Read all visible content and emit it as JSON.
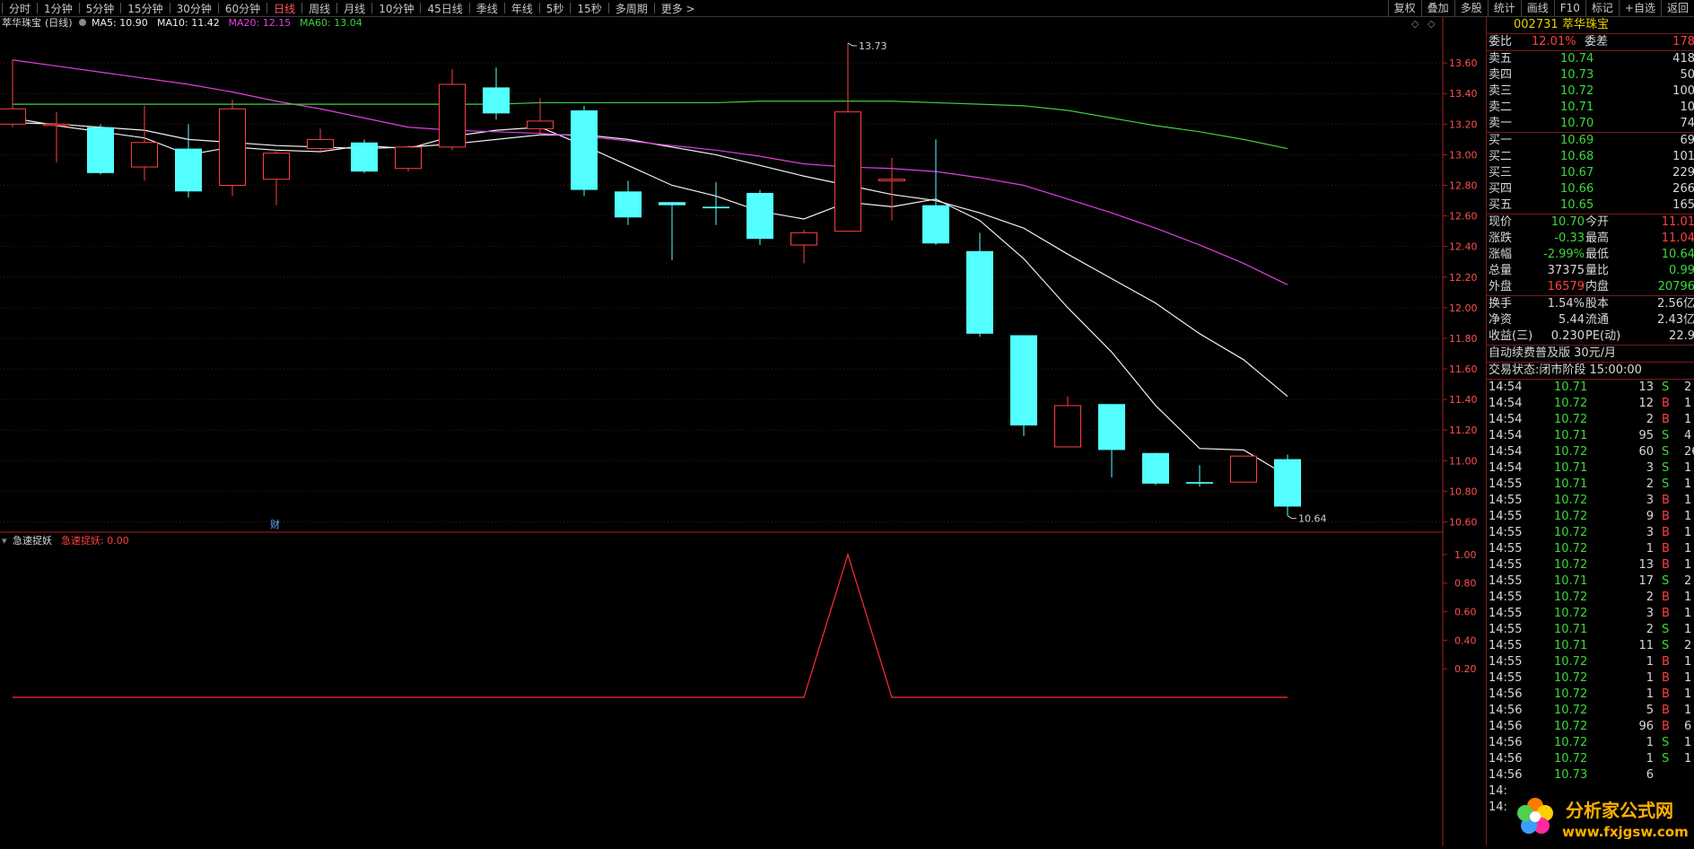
{
  "toolbar": {
    "tabs": [
      "分时",
      "1分钟",
      "5分钟",
      "15分钟",
      "30分钟",
      "60分钟",
      "日线",
      "周线",
      "月线",
      "10分钟",
      "45日线",
      "季线",
      "年线",
      "5秒",
      "15秒",
      "多周期",
      "更多 >"
    ],
    "active": "日线",
    "tools": [
      "复权",
      "叠加",
      "多股",
      "统计",
      "画线",
      "F10",
      "标记",
      "+自选",
      "返回"
    ]
  },
  "legend": {
    "name": "萃华珠宝",
    "period": "(日线)",
    "items": [
      {
        "label": "MA5: 10.90",
        "color": "#f0f0f0"
      },
      {
        "label": "MA10: 11.42",
        "color": "#f0f0f0"
      },
      {
        "label": "MA20: 12.15",
        "color": "#e040e0"
      },
      {
        "label": "MA60: 13.04",
        "color": "#40d040"
      }
    ]
  },
  "indicator": {
    "name": "急速捉妖",
    "label": "急速捉妖: 0.00",
    "color": "#ff4040"
  },
  "marker": {
    "text": "财"
  },
  "chart_data": [
    {
      "type": "candlestick",
      "title": "萃华珠宝 (日线)",
      "ylim": [
        10.55,
        13.9
      ],
      "yticks": [
        "13.60",
        "13.40",
        "13.20",
        "13.00",
        "12.80",
        "12.60",
        "12.40",
        "12.20",
        "12.00",
        "11.80",
        "11.60",
        "11.40",
        "11.20",
        "11.00",
        "10.80",
        "10.60"
      ],
      "annotations": [
        {
          "text": "13.73",
          "candle": 19,
          "value": 13.73
        },
        {
          "text": "10.64",
          "candle": 29,
          "value": 10.64
        }
      ],
      "candles": [
        {
          "o": 13.2,
          "h": 13.62,
          "l": 13.18,
          "c": 13.3
        },
        {
          "o": 13.2,
          "h": 13.28,
          "l": 12.95,
          "c": 13.2
        },
        {
          "o": 13.18,
          "h": 13.2,
          "l": 12.87,
          "c": 12.88
        },
        {
          "o": 12.92,
          "h": 13.32,
          "l": 12.83,
          "c": 13.08
        },
        {
          "o": 13.04,
          "h": 13.2,
          "l": 12.72,
          "c": 12.76
        },
        {
          "o": 12.8,
          "h": 13.36,
          "l": 12.73,
          "c": 13.3
        },
        {
          "o": 12.84,
          "h": 13.03,
          "l": 12.67,
          "c": 13.01
        },
        {
          "o": 13.04,
          "h": 13.17,
          "l": 13.02,
          "c": 13.1
        },
        {
          "o": 13.08,
          "h": 13.1,
          "l": 12.88,
          "c": 12.89
        },
        {
          "o": 12.91,
          "h": 13.06,
          "l": 12.89,
          "c": 13.05
        },
        {
          "o": 13.05,
          "h": 13.56,
          "l": 13.03,
          "c": 13.46
        },
        {
          "o": 13.44,
          "h": 13.57,
          "l": 13.23,
          "c": 13.27
        },
        {
          "o": 13.17,
          "h": 13.37,
          "l": 13.13,
          "c": 13.22
        },
        {
          "o": 13.29,
          "h": 13.32,
          "l": 12.73,
          "c": 12.77
        },
        {
          "o": 12.76,
          "h": 12.83,
          "l": 12.54,
          "c": 12.59
        },
        {
          "o": 12.69,
          "h": 12.69,
          "l": 12.31,
          "c": 12.67
        },
        {
          "o": 12.66,
          "h": 12.82,
          "l": 12.54,
          "c": 12.65
        },
        {
          "o": 12.75,
          "h": 12.77,
          "l": 12.41,
          "c": 12.45
        },
        {
          "o": 12.41,
          "h": 12.51,
          "l": 12.29,
          "c": 12.49
        },
        {
          "o": 12.5,
          "h": 13.73,
          "l": 12.5,
          "c": 13.28
        },
        {
          "o": 12.83,
          "h": 12.98,
          "l": 12.57,
          "c": 12.84
        },
        {
          "o": 12.67,
          "h": 13.1,
          "l": 12.41,
          "c": 12.42
        },
        {
          "o": 12.37,
          "h": 12.49,
          "l": 11.81,
          "c": 11.83
        },
        {
          "o": 11.82,
          "h": 11.82,
          "l": 11.16,
          "c": 11.23
        },
        {
          "o": 11.09,
          "h": 11.42,
          "l": 11.09,
          "c": 11.36
        },
        {
          "o": 11.37,
          "h": 11.37,
          "l": 10.89,
          "c": 11.07
        },
        {
          "o": 11.05,
          "h": 11.05,
          "l": 10.84,
          "c": 10.85
        },
        {
          "o": 10.86,
          "h": 10.97,
          "l": 10.83,
          "c": 10.85
        },
        {
          "o": 10.86,
          "h": 11.03,
          "l": 10.86,
          "c": 11.03
        },
        {
          "o": 11.01,
          "h": 11.04,
          "l": 10.64,
          "c": 10.7
        }
      ],
      "ma": [
        {
          "name": "MA5",
          "color": "#f0f0f0",
          "start": 0,
          "values": [
            13.24,
            13.19,
            13.15,
            13.11,
            13.0,
            13.05,
            13.03,
            13.02,
            13.06,
            13.04,
            13.12,
            13.16,
            13.18,
            13.06,
            12.93,
            12.8,
            12.73,
            12.63,
            12.58,
            12.69,
            12.66,
            12.71,
            12.57,
            12.32,
            12.0,
            11.71,
            11.36,
            11.08,
            11.07,
            10.9
          ]
        },
        {
          "name": "MA10",
          "color": "#f0f0f0",
          "start": 0,
          "values": [
            13.21,
            13.2,
            13.18,
            13.16,
            13.1,
            13.08,
            13.06,
            13.05,
            13.04,
            13.05,
            13.07,
            13.1,
            13.13,
            13.13,
            13.1,
            13.05,
            13.0,
            12.93,
            12.86,
            12.8,
            12.74,
            12.7,
            12.62,
            12.52,
            12.35,
            12.19,
            12.03,
            11.83,
            11.66,
            11.42
          ]
        },
        {
          "name": "MA20",
          "color": "#e040e0",
          "start": 0,
          "values": [
            13.62,
            13.58,
            13.54,
            13.5,
            13.46,
            13.41,
            13.35,
            13.3,
            13.24,
            13.18,
            13.16,
            13.15,
            13.14,
            13.12,
            13.09,
            13.06,
            13.03,
            12.99,
            12.94,
            12.92,
            12.91,
            12.89,
            12.85,
            12.8,
            12.71,
            12.62,
            12.52,
            12.41,
            12.29,
            12.15
          ]
        },
        {
          "name": "MA60",
          "color": "#40d040",
          "start": 0,
          "values": [
            13.33,
            13.33,
            13.33,
            13.33,
            13.33,
            13.33,
            13.33,
            13.33,
            13.33,
            13.33,
            13.33,
            13.33,
            13.34,
            13.34,
            13.34,
            13.34,
            13.34,
            13.35,
            13.35,
            13.35,
            13.35,
            13.34,
            13.33,
            13.32,
            13.29,
            13.24,
            13.19,
            13.15,
            13.1,
            13.04
          ]
        }
      ]
    },
    {
      "type": "line",
      "title": "急速捉妖",
      "ylim": [
        0,
        1.1
      ],
      "yticks": [
        "1.00",
        "0.80",
        "0.60",
        "0.40",
        "0.20"
      ],
      "series": [
        {
          "name": "急速捉妖",
          "values": [
            0,
            0,
            0,
            0,
            0,
            0,
            0,
            0,
            0,
            0,
            0,
            0,
            0,
            0,
            0,
            0,
            0,
            0,
            0,
            1,
            0,
            0,
            0,
            0,
            0,
            0,
            0,
            0,
            0,
            0
          ]
        }
      ]
    }
  ],
  "quote": {
    "code": "002731",
    "name": "萃华珠宝",
    "weibi_label": "委比",
    "weibi_value": "12.01%",
    "weicha_label": "委差",
    "weicha_value": "178",
    "sells": [
      {
        "label": "卖五",
        "price": "10.74",
        "vol": "418"
      },
      {
        "label": "卖四",
        "price": "10.73",
        "vol": "50"
      },
      {
        "label": "卖三",
        "price": "10.72",
        "vol": "100"
      },
      {
        "label": "卖二",
        "price": "10.71",
        "vol": "10"
      },
      {
        "label": "卖一",
        "price": "10.70",
        "vol": "74"
      }
    ],
    "buys": [
      {
        "label": "买一",
        "price": "10.69",
        "vol": "69"
      },
      {
        "label": "买二",
        "price": "10.68",
        "vol": "101"
      },
      {
        "label": "买三",
        "price": "10.67",
        "vol": "229"
      },
      {
        "label": "买四",
        "price": "10.66",
        "vol": "266"
      },
      {
        "label": "买五",
        "price": "10.65",
        "vol": "165"
      }
    ],
    "stats": [
      {
        "l1": "现价",
        "v1": "10.70",
        "c1": "green",
        "l2": "今开",
        "v2": "11.01",
        "c2": "red"
      },
      {
        "l1": "涨跌",
        "v1": "-0.33",
        "c1": "green",
        "l2": "最高",
        "v2": "11.04",
        "c2": "red"
      },
      {
        "l1": "涨幅",
        "v1": "-2.99%",
        "c1": "green",
        "l2": "最低",
        "v2": "10.64",
        "c2": "green"
      },
      {
        "l1": "总量",
        "v1": "37375",
        "c1": "white",
        "l2": "量比",
        "v2": "0.99",
        "c2": "green"
      },
      {
        "l1": "外盘",
        "v1": "16579",
        "c1": "red",
        "l2": "内盘",
        "v2": "20796",
        "c2": "green"
      }
    ],
    "stats2": [
      {
        "l1": "换手",
        "v1": "1.54%",
        "l2": "股本",
        "v2": "2.56亿"
      },
      {
        "l1": "净资",
        "v1": "5.44",
        "l2": "流通",
        "v2": "2.43亿"
      },
      {
        "l1": "收益(三)",
        "v1": "0.230",
        "l2": "PE(动)",
        "v2": "22.9"
      }
    ],
    "promo": "自动续费普及版  30元/月",
    "status": "交易状态:闭市阶段 15:00:00",
    "ticks": [
      {
        "t": "14:54",
        "p": "10.71",
        "pc": "green",
        "v": "13",
        "s": "S",
        "n": "2"
      },
      {
        "t": "14:54",
        "p": "10.72",
        "pc": "green",
        "v": "12",
        "s": "B",
        "n": "1"
      },
      {
        "t": "14:54",
        "p": "10.72",
        "pc": "green",
        "v": "2",
        "s": "B",
        "n": "1"
      },
      {
        "t": "14:54",
        "p": "10.71",
        "pc": "green",
        "v": "95",
        "s": "S",
        "n": "4"
      },
      {
        "t": "14:54",
        "p": "10.72",
        "pc": "green",
        "v": "60",
        "s": "S",
        "n": "26"
      },
      {
        "t": "14:54",
        "p": "10.71",
        "pc": "green",
        "v": "3",
        "s": "S",
        "n": "1"
      },
      {
        "t": "14:55",
        "p": "10.71",
        "pc": "green",
        "v": "2",
        "s": "S",
        "n": "1"
      },
      {
        "t": "14:55",
        "p": "10.72",
        "pc": "green",
        "v": "3",
        "s": "B",
        "n": "1"
      },
      {
        "t": "14:55",
        "p": "10.72",
        "pc": "green",
        "v": "9",
        "s": "B",
        "n": "1"
      },
      {
        "t": "14:55",
        "p": "10.72",
        "pc": "green",
        "v": "3",
        "s": "B",
        "n": "1"
      },
      {
        "t": "14:55",
        "p": "10.72",
        "pc": "green",
        "v": "1",
        "s": "B",
        "n": "1"
      },
      {
        "t": "14:55",
        "p": "10.72",
        "pc": "green",
        "v": "13",
        "s": "B",
        "n": "1"
      },
      {
        "t": "14:55",
        "p": "10.71",
        "pc": "green",
        "v": "17",
        "s": "S",
        "n": "2"
      },
      {
        "t": "14:55",
        "p": "10.72",
        "pc": "green",
        "v": "2",
        "s": "B",
        "n": "1"
      },
      {
        "t": "14:55",
        "p": "10.72",
        "pc": "green",
        "v": "3",
        "s": "B",
        "n": "1"
      },
      {
        "t": "14:55",
        "p": "10.71",
        "pc": "green",
        "v": "2",
        "s": "S",
        "n": "1"
      },
      {
        "t": "14:55",
        "p": "10.71",
        "pc": "green",
        "v": "11",
        "s": "S",
        "n": "2"
      },
      {
        "t": "14:55",
        "p": "10.72",
        "pc": "green",
        "v": "1",
        "s": "B",
        "n": "1"
      },
      {
        "t": "14:55",
        "p": "10.72",
        "pc": "green",
        "v": "1",
        "s": "B",
        "n": "1"
      },
      {
        "t": "14:56",
        "p": "10.72",
        "pc": "green",
        "v": "1",
        "s": "B",
        "n": "1"
      },
      {
        "t": "14:56",
        "p": "10.72",
        "pc": "green",
        "v": "5",
        "s": "B",
        "n": "1"
      },
      {
        "t": "14:56",
        "p": "10.72",
        "pc": "green",
        "v": "96",
        "s": "B",
        "n": "6"
      },
      {
        "t": "14:56",
        "p": "10.72",
        "pc": "green",
        "v": "1",
        "s": "S",
        "n": "1"
      },
      {
        "t": "14:56",
        "p": "10.72",
        "pc": "green",
        "v": "1",
        "s": "S",
        "n": "1"
      },
      {
        "t": "14:56",
        "p": "10.73",
        "pc": "green",
        "v": "6",
        "s": "",
        "n": ""
      },
      {
        "t": "14:",
        "p": "",
        "pc": "green",
        "v": "",
        "s": "",
        "n": ""
      },
      {
        "t": "14:",
        "p": "",
        "pc": "green",
        "v": "",
        "s": "",
        "n": ""
      }
    ]
  },
  "watermark": {
    "title": "分析家公式网",
    "url": "www.fxjgsw.com"
  },
  "colors": {
    "up": "#ff4040",
    "down": "#53ffff",
    "grid": "#7a1a1a",
    "axis": "#aa2020"
  }
}
